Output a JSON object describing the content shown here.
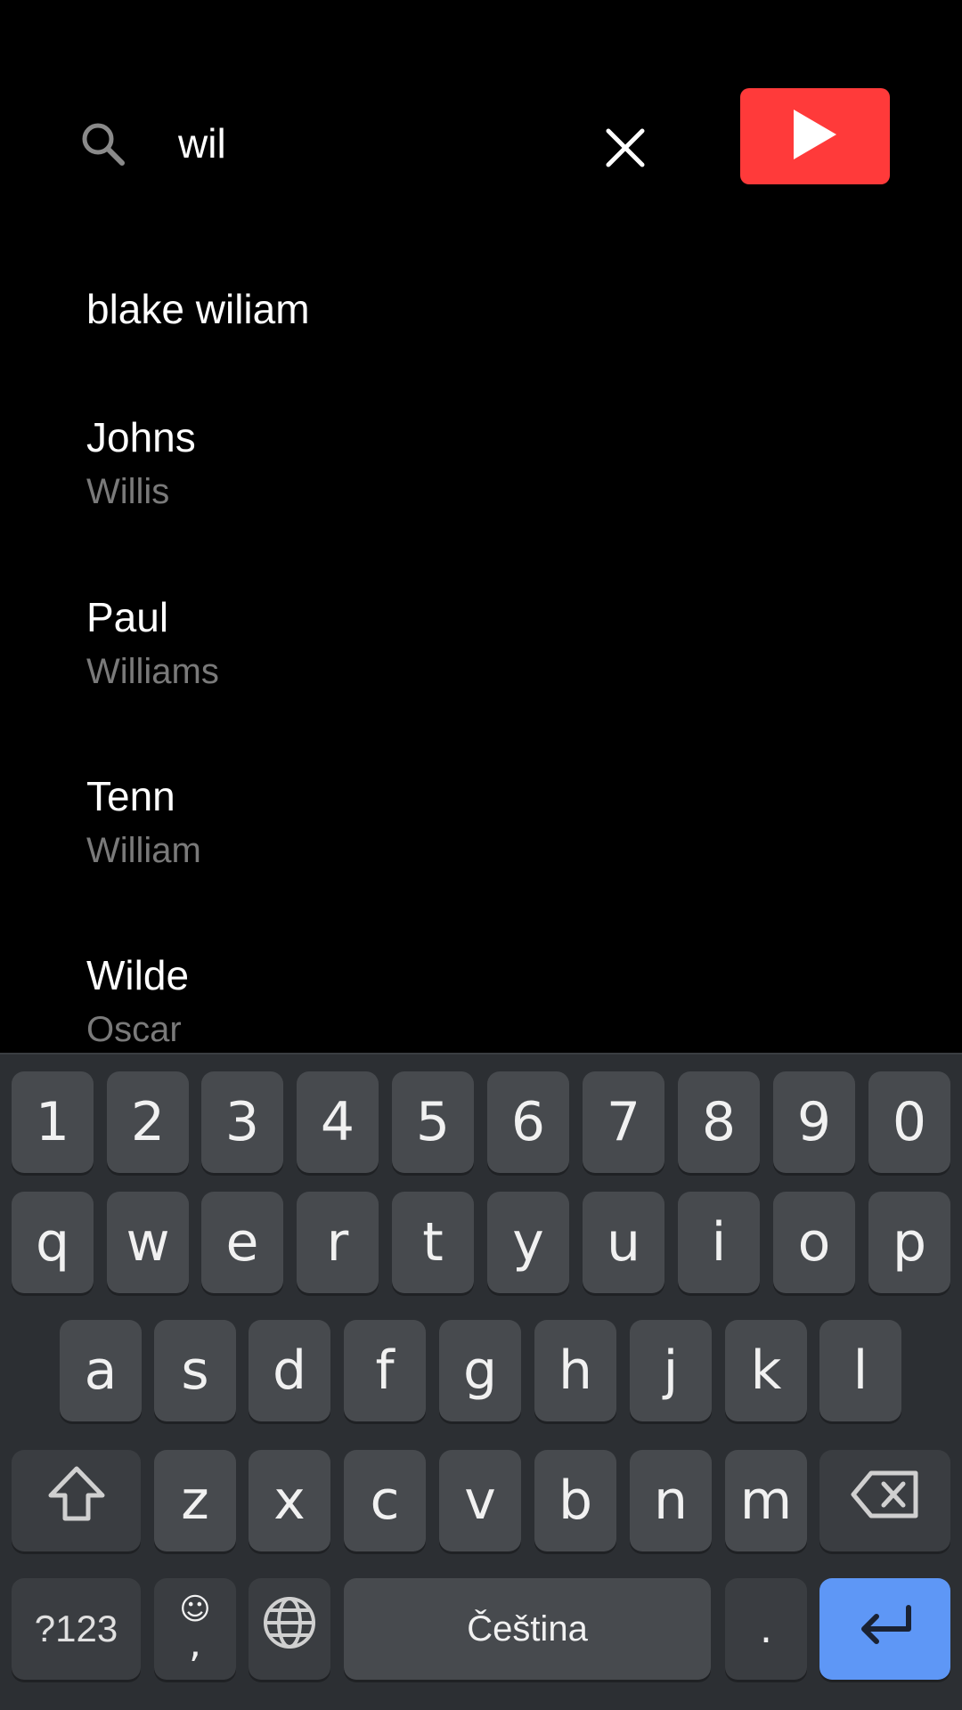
{
  "search": {
    "value": "wil",
    "icon": "search-icon",
    "clear_icon": "close-icon",
    "play_icon": "play-icon",
    "play_color": "#ff3a3a"
  },
  "suggestions": [
    {
      "primary": "blake wiliam",
      "secondary": ""
    },
    {
      "primary": "Johns",
      "secondary": "Willis"
    },
    {
      "primary": "Paul",
      "secondary": "Williams"
    },
    {
      "primary": "Tenn",
      "secondary": "William"
    },
    {
      "primary": "Wilde",
      "secondary": "Oscar"
    }
  ],
  "keyboard": {
    "row_numbers": [
      "1",
      "2",
      "3",
      "4",
      "5",
      "6",
      "7",
      "8",
      "9",
      "0"
    ],
    "row_1": [
      "q",
      "w",
      "e",
      "r",
      "t",
      "y",
      "u",
      "i",
      "o",
      "p"
    ],
    "row_2": [
      "a",
      "s",
      "d",
      "f",
      "g",
      "h",
      "j",
      "k",
      "l"
    ],
    "row_3": [
      "z",
      "x",
      "c",
      "v",
      "b",
      "n",
      "m"
    ],
    "symbols_label": "?123",
    "emoji_glyph": "☺",
    "comma_label": ",",
    "space_label": "Čeština",
    "period_label": ".",
    "shift_icon": "shift-icon",
    "backspace_icon": "backspace-icon",
    "globe_icon": "globe-icon",
    "enter_icon": "enter-icon",
    "enter_color": "#5e97f6"
  }
}
